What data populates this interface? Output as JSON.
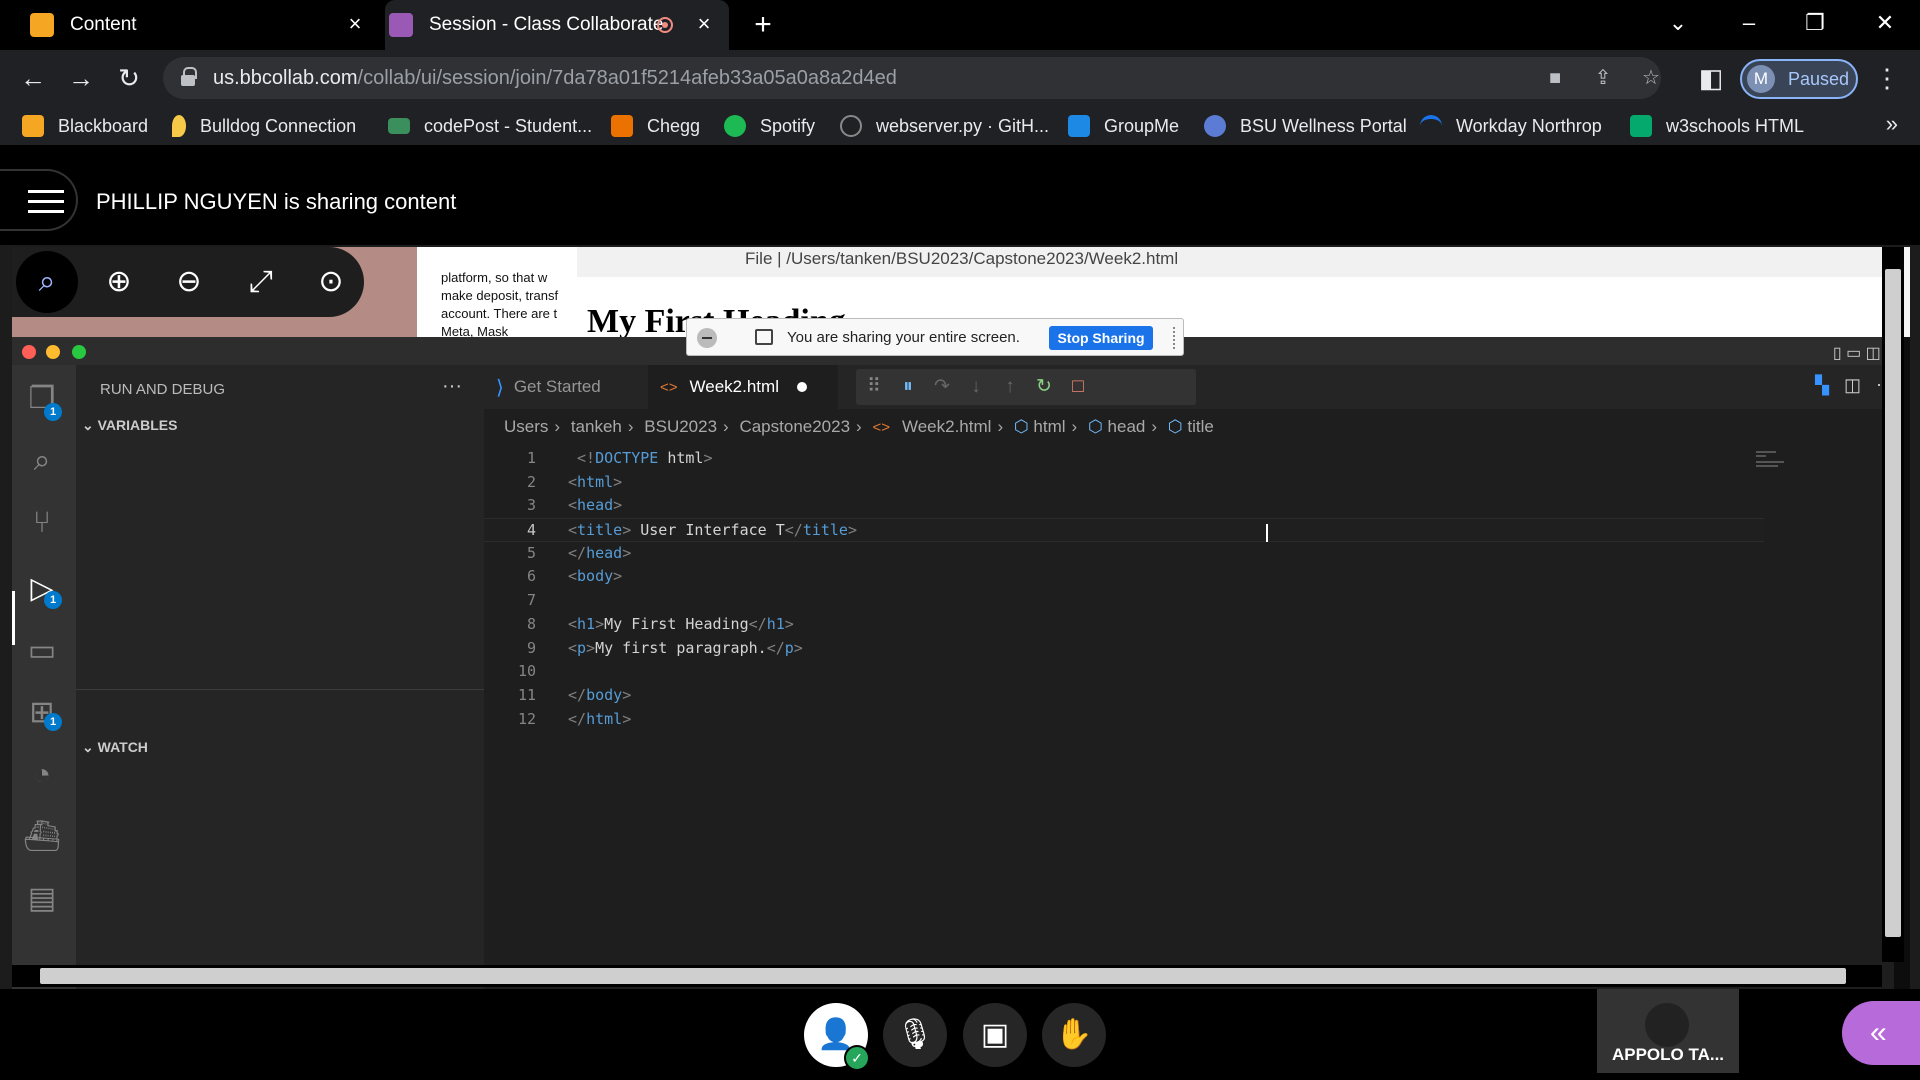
{
  "browser": {
    "tabs": [
      {
        "title": "Content",
        "favicon_color": "#f5a623"
      },
      {
        "title": "Session - Class Collaborate",
        "favicon_color": "#9b59b6",
        "recording": true
      }
    ],
    "new_tab_icon": "plus-icon",
    "url_host": "us.bbcollab.com",
    "url_path": "/collab/ui/session/join/7da78a01f5214afeb33a05a0a8a2d4ed",
    "profile_initial": "M",
    "profile_status": "Paused",
    "bookmarks": [
      {
        "label": "Blackboard",
        "color": "#f5a623"
      },
      {
        "label": "Bulldog Connection",
        "color": "#f7c948"
      },
      {
        "label": "codePost - Student...",
        "color": "#3a8f5c"
      },
      {
        "label": "Chegg",
        "color": "#eb7100"
      },
      {
        "label": "Spotify",
        "color": "#1db954"
      },
      {
        "label": "webserver.py · GitH...",
        "color": "#888888"
      },
      {
        "label": "GroupMe",
        "color": "#1e88e5"
      },
      {
        "label": "BSU Wellness Portal",
        "color": "#5b7bd5"
      },
      {
        "label": "Workday Northrop",
        "color": "#1a73e8"
      },
      {
        "label": "w3schools HTML",
        "color": "#04aa6d"
      }
    ],
    "bookmarks_more": "»"
  },
  "collab": {
    "sharing_text": "PHILLIP NGUYEN is sharing content",
    "share_notice": "You are sharing your entire screen.",
    "stop_sharing": "Stop Sharing",
    "attendee_name": "APPOLO TA..."
  },
  "background_window": {
    "doc_text": [
      "platform, so that w",
      "make deposit, transf",
      "account. There are t",
      "Meta, Mask"
    ],
    "url": "File  |  /Users/tanken/BSU2023/Capstone2023/Week2.html",
    "heading": "My First Heading"
  },
  "vscode": {
    "sidebar_title": "RUN AND DEBUG",
    "sections": [
      "VARIABLES",
      "WATCH"
    ],
    "tabs": [
      "Get Started",
      "Week2.html"
    ],
    "breadcrumb": [
      "Users",
      "tankeh",
      "BSU2023",
      "Capstone2023",
      "Week2.html",
      "html",
      "head",
      "title"
    ],
    "badges": {
      "explorer": "1",
      "debug": "1",
      "extensions": "1"
    },
    "current_line": 4,
    "lines": [
      {
        "n": "1",
        "parts": [
          [
            "tag",
            " <!"
          ],
          [
            "tname",
            "DOCTYPE"
          ],
          [
            "txt",
            " html"
          ],
          [
            "tag",
            ">"
          ]
        ]
      },
      {
        "n": "2",
        "parts": [
          [
            "tag",
            "<"
          ],
          [
            "tname",
            "html"
          ],
          [
            "tag",
            ">"
          ]
        ]
      },
      {
        "n": "3",
        "parts": [
          [
            "tag",
            "<"
          ],
          [
            "tname",
            "head"
          ],
          [
            "tag",
            ">"
          ]
        ]
      },
      {
        "n": "4",
        "parts": [
          [
            "tag",
            "<"
          ],
          [
            "tname",
            "title"
          ],
          [
            "tag",
            "> "
          ],
          [
            "txt",
            "User Interface T"
          ],
          [
            "tag",
            "</"
          ],
          [
            "tname",
            "title"
          ],
          [
            "tag",
            ">"
          ]
        ]
      },
      {
        "n": "5",
        "parts": [
          [
            "tag",
            "</"
          ],
          [
            "tname",
            "head"
          ],
          [
            "tag",
            ">"
          ]
        ]
      },
      {
        "n": "6",
        "parts": [
          [
            "tag",
            "<"
          ],
          [
            "tname",
            "body"
          ],
          [
            "tag",
            ">"
          ]
        ]
      },
      {
        "n": "7",
        "parts": []
      },
      {
        "n": "8",
        "parts": [
          [
            "tag",
            "<"
          ],
          [
            "tname",
            "h1"
          ],
          [
            "tag",
            ">"
          ],
          [
            "txt",
            "My First Heading"
          ],
          [
            "tag",
            "</"
          ],
          [
            "tname",
            "h1"
          ],
          [
            "tag",
            ">"
          ]
        ]
      },
      {
        "n": "9",
        "parts": [
          [
            "tag",
            "<"
          ],
          [
            "tname",
            "p"
          ],
          [
            "tag",
            ">"
          ],
          [
            "txt",
            "My first paragraph."
          ],
          [
            "tag",
            "</"
          ],
          [
            "tname",
            "p"
          ],
          [
            "tag",
            ">"
          ]
        ]
      },
      {
        "n": "10",
        "parts": []
      },
      {
        "n": "11",
        "parts": [
          [
            "tag",
            "</"
          ],
          [
            "tname",
            "body"
          ],
          [
            "tag",
            ">"
          ]
        ]
      },
      {
        "n": "12",
        "parts": [
          [
            "tag",
            "</"
          ],
          [
            "tname",
            "html"
          ],
          [
            "tag",
            ">"
          ]
        ]
      }
    ]
  },
  "colors": {
    "accent": "#007acc",
    "collab_purple": "#b76bdb",
    "stop_sharing_blue": "#1a73e8"
  }
}
